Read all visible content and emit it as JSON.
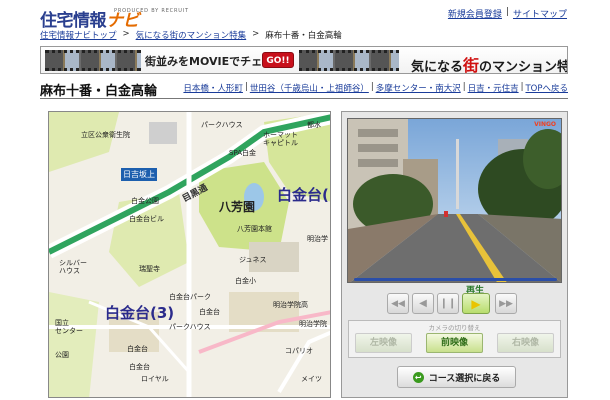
{
  "header": {
    "logo_text": "住宅情報",
    "logo_navi": "ナビ",
    "logo_sub": "PRODUCED BY RECRUIT",
    "links": [
      "新規会員登録",
      "サイトマップ"
    ],
    "link_sep": "|"
  },
  "breadcrumb": {
    "items": [
      "住宅情報ナビトップ",
      "気になる街のマンション特集",
      "麻布十番・白金高輪"
    ],
    "sep": ">"
  },
  "banner": {
    "text": "街並みをMOVIEでチェック！",
    "go": "GO!!",
    "title_pre": "気になる",
    "title_red": "街",
    "title_post": "のマンション特集"
  },
  "area": {
    "title": "麻布十番・白金高輪",
    "nav": [
      "日本橋・人形町",
      "世田谷（千歳烏山・上祖師谷）",
      "多摩センター・南大沢",
      "日吉・元住吉",
      "TOPへ戻る"
    ],
    "sep": "|"
  },
  "map": {
    "big_labels": [
      "白金台(",
      "白金台(3)"
    ],
    "park": "八芳園",
    "station": "日吉坂上",
    "road": "目黒通",
    "labels": [
      "立区公衆衛生院",
      "パークハウス",
      "都水",
      "SPA白金",
      "ホーマット",
      "キャピトル",
      "白金公園",
      "白金台ビル",
      "瑞聖寺",
      "八芳園本館",
      "明治学",
      "ジュネス",
      "白金小",
      "白金台パーク",
      "明治学院高",
      "明治学院",
      "白金台",
      "パークハウス",
      "コパリオ",
      "白金台",
      "公園",
      "白金台",
      "メイツ",
      "国立",
      "センター",
      "ロイヤル",
      "シルバー",
      "ハウス"
    ]
  },
  "video": {
    "logo": "VINGO",
    "progress": 0.0
  },
  "controls": {
    "play_label": "再生",
    "camera_title": "カメラの切り替え",
    "cameras": [
      "左映像",
      "前映像",
      "右映像"
    ],
    "active_camera": "前映像",
    "back": "コース選択に戻る"
  }
}
